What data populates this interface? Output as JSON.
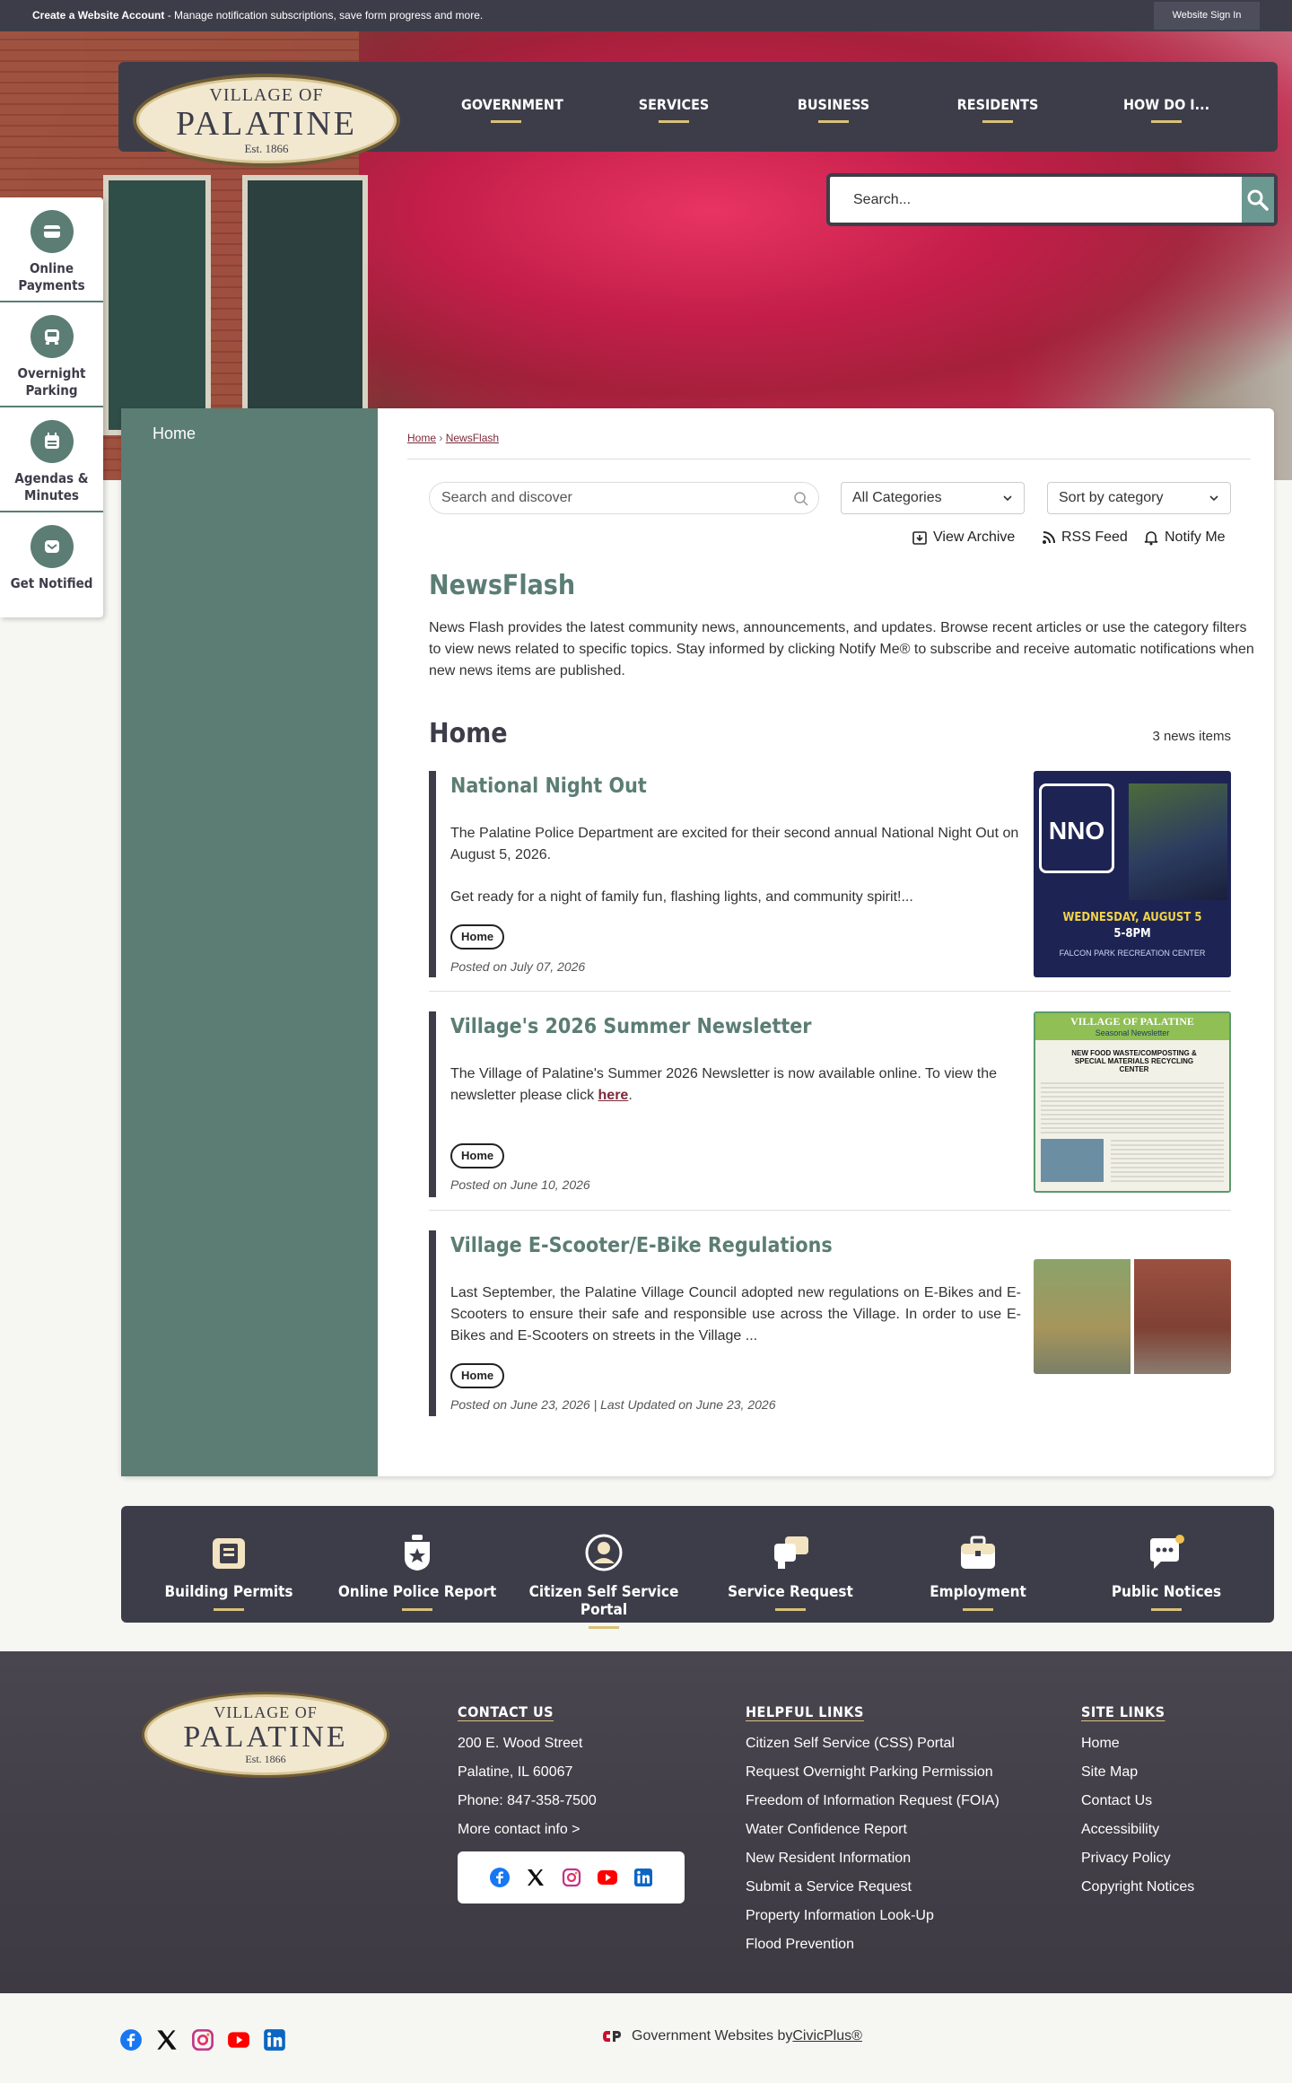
{
  "topbar": {
    "create_account": "Create a Website Account",
    "create_desc": " - Manage notification subscriptions, save form progress and more.",
    "sign_in": "Website Sign In"
  },
  "logo": {
    "top": "VILLAGE OF",
    "main": "PALATINE",
    "est": "Est. 1866"
  },
  "nav": [
    "GOVERNMENT",
    "SERVICES",
    "BUSINESS",
    "RESIDENTS",
    "HOW DO I..."
  ],
  "search": {
    "placeholder": "Search..."
  },
  "quicklinks": [
    {
      "label": "Online Payments",
      "icon": "payment-icon"
    },
    {
      "label": "Overnight Parking",
      "icon": "car-icon"
    },
    {
      "label": "Agendas & Minutes",
      "icon": "calendar-icon"
    },
    {
      "label": "Get Notified",
      "icon": "mail-icon"
    }
  ],
  "leftnav": {
    "home": "Home"
  },
  "breadcrumb": {
    "home": "Home",
    "sep": " › ",
    "current": "NewsFlash"
  },
  "filters": {
    "search_placeholder": "Search and discover",
    "category": "All Categories",
    "sort": "Sort by category",
    "view_archive": "View Archive",
    "rss": "RSS Feed",
    "notify": "Notify Me"
  },
  "page": {
    "title": "NewsFlash",
    "description": "News Flash provides the latest community news, announcements, and updates. Browse recent articles or use the category filters to view news related to specific topics. Stay informed by clicking Notify Me® to subscribe and receive automatic notifications when new news items are published.",
    "section": "Home",
    "count": "3 news items"
  },
  "news": [
    {
      "title": "National Night Out",
      "body1": "The Palatine Police Department are excited for their second annual National Night Out on August 5, 2026.",
      "body2": "Get ready for a night of family fun, flashing lights, and community spirit!...",
      "tag": "Home",
      "posted": "Posted on July 07, 2026",
      "thumb": {
        "line1": "WEDNESDAY, AUGUST 5",
        "line2": "5-8PM",
        "line3": "FALCON PARK RECREATION CENTER",
        "badge": "NNO"
      }
    },
    {
      "title": "Village's 2026 Summer Newsletter",
      "body1": "The Village of Palatine's Summer 2026 Newsletter is now available online.  To view the newsletter please click ",
      "link": "here",
      "tag": "Home",
      "posted": "Posted on June 10, 2026",
      "thumb": {
        "header": "VILLAGE OF PALATINE",
        "sub": "Seasonal Newsletter",
        "headline": "NEW FOOD WASTE/COMPOSTING & SPECIAL MATERIALS RECYCLING CENTER"
      }
    },
    {
      "title": "Village E-Scooter/E-Bike Regulations",
      "body1": "Last September, the Palatine Village Council adopted new regulations on E-Bikes and E-Scooters to ensure their safe and responsible use across the Village. In order to use E-Bikes and E-Scooters on streets in the Village ...",
      "tag": "Home",
      "posted": "Posted on June 23, 2026 | Last Updated on June 23, 2026"
    }
  ],
  "features": [
    {
      "label": "Building Permits",
      "icon": "building-permit-icon"
    },
    {
      "label": "Online Police Report",
      "icon": "police-badge-icon"
    },
    {
      "label": "Citizen Self Service Portal",
      "icon": "user-circle-icon"
    },
    {
      "label": "Service Request",
      "icon": "service-request-icon"
    },
    {
      "label": "Employment",
      "icon": "briefcase-icon"
    },
    {
      "label": "Public Notices",
      "icon": "chat-bubble-icon"
    }
  ],
  "footer": {
    "contact": {
      "heading": "CONTACT US",
      "address1": "200 E. Wood Street",
      "address2": "Palatine, IL 60067",
      "phone": "Phone: 847-358-7500",
      "more": "More contact info >"
    },
    "helpful": {
      "heading": "HELPFUL LINKS",
      "links": [
        "Citizen Self Service (CSS) Portal",
        "Request Overnight Parking Permission",
        "Freedom of Information Request (FOIA)",
        "Water Confidence Report",
        "New Resident Information",
        "Submit a Service Request",
        "Property Information Look-Up",
        "Flood Prevention"
      ]
    },
    "site": {
      "heading": "SITE LINKS",
      "links": [
        "Home",
        "Site Map",
        "Contact Us",
        "Accessibility",
        "Privacy Policy",
        "Copyright Notices"
      ]
    }
  },
  "social": [
    "facebook-icon",
    "x-icon",
    "instagram-icon",
    "youtube-icon",
    "linkedin-icon"
  ],
  "colors": {
    "facebook": "#1877f2",
    "instagram": "#c13584",
    "youtube": "#ff0000",
    "linkedin": "#0a66c2",
    "accent": "#5b7d74",
    "dark": "#3d3d4a"
  },
  "civic": {
    "prefix": "Government Websites by ",
    "link": "CivicPlus®"
  }
}
